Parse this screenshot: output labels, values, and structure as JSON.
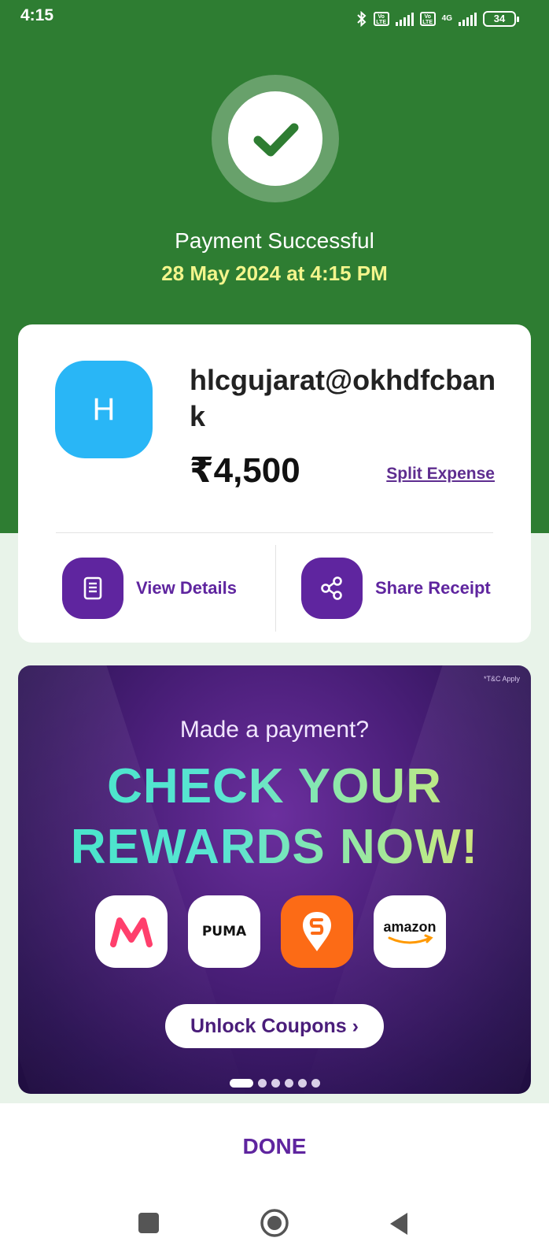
{
  "status_bar": {
    "time": "4:15",
    "network": "4G",
    "battery": "34"
  },
  "success": {
    "title": "Payment Successful",
    "datetime": "28 May 2024 at 4:15 PM"
  },
  "transaction": {
    "avatar_letter": "H",
    "payee": "hlcgujarat@okhdfcbank",
    "amount": "₹4,500",
    "split_label": "Split Expense"
  },
  "actions": {
    "view_details": "View Details",
    "share_receipt": "Share Receipt"
  },
  "banner": {
    "tnc": "*T&C Apply",
    "subtitle": "Made a payment?",
    "headline_line1": "CHECK YOUR",
    "headline_line2": "REWARDS NOW!",
    "brands": [
      "myntra",
      "PUMA",
      "swiggy",
      "amazon"
    ],
    "button": "Unlock Coupons ›",
    "slides_total": 6,
    "slide_active": 1
  },
  "done_label": "DONE",
  "colors": {
    "header_green": "#2e7d32",
    "accent_purple": "#5f259f",
    "date_yellow": "#f3f58c",
    "avatar_blue": "#29b6f6"
  }
}
